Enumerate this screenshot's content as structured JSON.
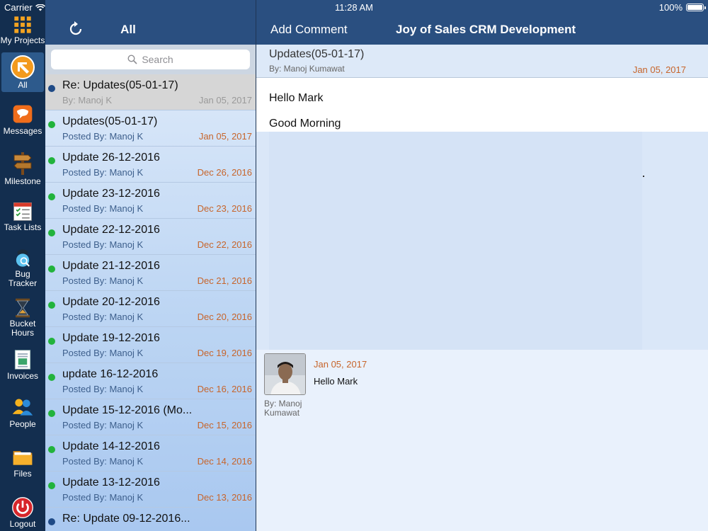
{
  "status": {
    "carrier": "Carrier",
    "time": "11:28 AM",
    "battery": "100%"
  },
  "tabs": [
    {
      "label": "My Projects",
      "icon": "grid-icon"
    },
    {
      "label": "All",
      "icon": "all-icon",
      "active": true
    },
    {
      "label": "Messages",
      "icon": "messages-icon"
    },
    {
      "label": "Milestone",
      "icon": "milestone-signpost-icon"
    },
    {
      "label": "Task Lists",
      "icon": "task-list-icon"
    },
    {
      "label": "Bug Tracker",
      "icon": "bug-icon"
    },
    {
      "label": "Bucket Hours",
      "icon": "hourglass-icon"
    },
    {
      "label": "Invoices",
      "icon": "invoice-icon"
    },
    {
      "label": "People",
      "icon": "people-icon"
    },
    {
      "label": "Files",
      "icon": "folder-icon"
    },
    {
      "label": "Logout",
      "icon": "power-icon"
    }
  ],
  "list": {
    "title": "All",
    "search_placeholder": "Search",
    "items": [
      {
        "title": "Re: Updates(05-01-17)",
        "by": "By: Manoj K",
        "date": "Jan 05, 2017",
        "dot": "#1f4a86",
        "selected": true
      },
      {
        "title": "Updates(05-01-17)",
        "by": "Posted By: Manoj K",
        "date": "Jan 05, 2017",
        "dot": "#22b33c"
      },
      {
        "title": "Update 26-12-2016",
        "by": "Posted By: Manoj K",
        "date": "Dec 26, 2016",
        "dot": "#22b33c"
      },
      {
        "title": "Update 23-12-2016",
        "by": "Posted By: Manoj K",
        "date": "Dec 23, 2016",
        "dot": "#22b33c"
      },
      {
        "title": "Update 22-12-2016",
        "by": "Posted By: Manoj K",
        "date": "Dec 22, 2016",
        "dot": "#22b33c"
      },
      {
        "title": "Update 21-12-2016",
        "by": "Posted By: Manoj K",
        "date": "Dec 21, 2016",
        "dot": "#22b33c"
      },
      {
        "title": "Update 20-12-2016",
        "by": "Posted By: Manoj K",
        "date": "Dec 20, 2016",
        "dot": "#22b33c"
      },
      {
        "title": "Update 19-12-2016",
        "by": "Posted By: Manoj K",
        "date": "Dec 19, 2016",
        "dot": "#22b33c"
      },
      {
        "title": "update 16-12-2016",
        "by": "Posted By: Manoj K",
        "date": "Dec 16, 2016",
        "dot": "#22b33c"
      },
      {
        "title": "Update 15-12-2016 (Mo...",
        "by": "Posted By: Manoj K",
        "date": "Dec 15, 2016",
        "dot": "#22b33c"
      },
      {
        "title": "Update 14-12-2016",
        "by": "Posted By: Manoj K",
        "date": "Dec 14, 2016",
        "dot": "#22b33c"
      },
      {
        "title": "Update 13-12-2016",
        "by": "Posted By: Manoj K",
        "date": "Dec 13, 2016",
        "dot": "#22b33c"
      },
      {
        "title": "Re: Update 09-12-2016...",
        "by": "",
        "date": "",
        "dot": "#1f4a86"
      }
    ]
  },
  "detail": {
    "add_comment": "Add Comment",
    "project_title": "Joy of Sales CRM Development",
    "subject": "Updates(05-01-17)",
    "author": "By: Manoj Kumawat",
    "date": "Jan 05, 2017",
    "body_line1": "Hello Mark",
    "body_line2": "Good Morning"
  },
  "comment": {
    "date": "Jan 05, 2017",
    "text": "Hello Mark",
    "by": "By: Manoj Kumawat"
  }
}
